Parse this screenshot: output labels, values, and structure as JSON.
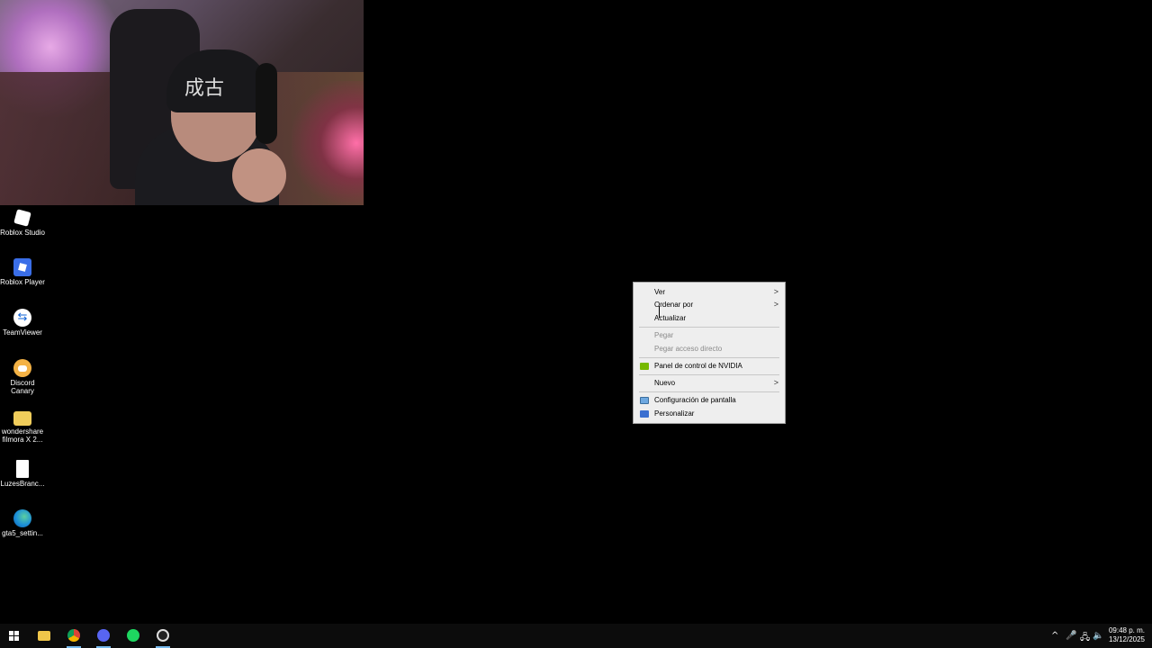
{
  "webcam": {
    "cap_text": "成古"
  },
  "desktop_icons": [
    {
      "label": "Roblox Studio",
      "icon": "roblox-studio-icon"
    },
    {
      "label": "Roblox Player",
      "icon": "roblox-player-icon"
    },
    {
      "label": "TeamViewer",
      "icon": "teamviewer-icon"
    },
    {
      "label": "Discord Canary",
      "icon": "discord-canary-icon"
    },
    {
      "label": "wondershare filmora X 2...",
      "icon": "folder-icon"
    },
    {
      "label": "LuzesBranc...",
      "icon": "file-icon"
    },
    {
      "label": "gta5_settin...",
      "icon": "edge-icon"
    }
  ],
  "context_menu": {
    "items": [
      {
        "label": "Ver",
        "has_submenu": true
      },
      {
        "label": "Ordenar por",
        "has_submenu": true
      },
      {
        "label": "Actualizar"
      },
      {
        "label": "Pegar",
        "disabled": true
      },
      {
        "label": "Pegar acceso directo",
        "disabled": true
      },
      {
        "label": "Panel de control de NVIDIA",
        "icon": "nvidia-icon"
      },
      {
        "label": "Nuevo",
        "has_submenu": true
      },
      {
        "label": "Configuración de pantalla",
        "icon": "display-settings-icon"
      },
      {
        "label": "Personalizar",
        "icon": "personalize-icon"
      }
    ],
    "submenu_arrow": ">"
  },
  "taskbar": {
    "apps": [
      "start",
      "file-explorer",
      "chrome",
      "discord",
      "spotify",
      "obs"
    ],
    "tray": {
      "chevron": "^",
      "mic": "🎤",
      "network": "🖧",
      "volume": "🔈"
    },
    "clock": {
      "time": "09:48 p. m.",
      "date": "13/12/2025"
    }
  },
  "colors": {
    "desktop_bg": "#000000",
    "menu_bg": "#eeeeee",
    "taskbar_bg": "#0c0c0c",
    "nvidia_green": "#76b900",
    "active_indicator": "#76b9ed"
  }
}
